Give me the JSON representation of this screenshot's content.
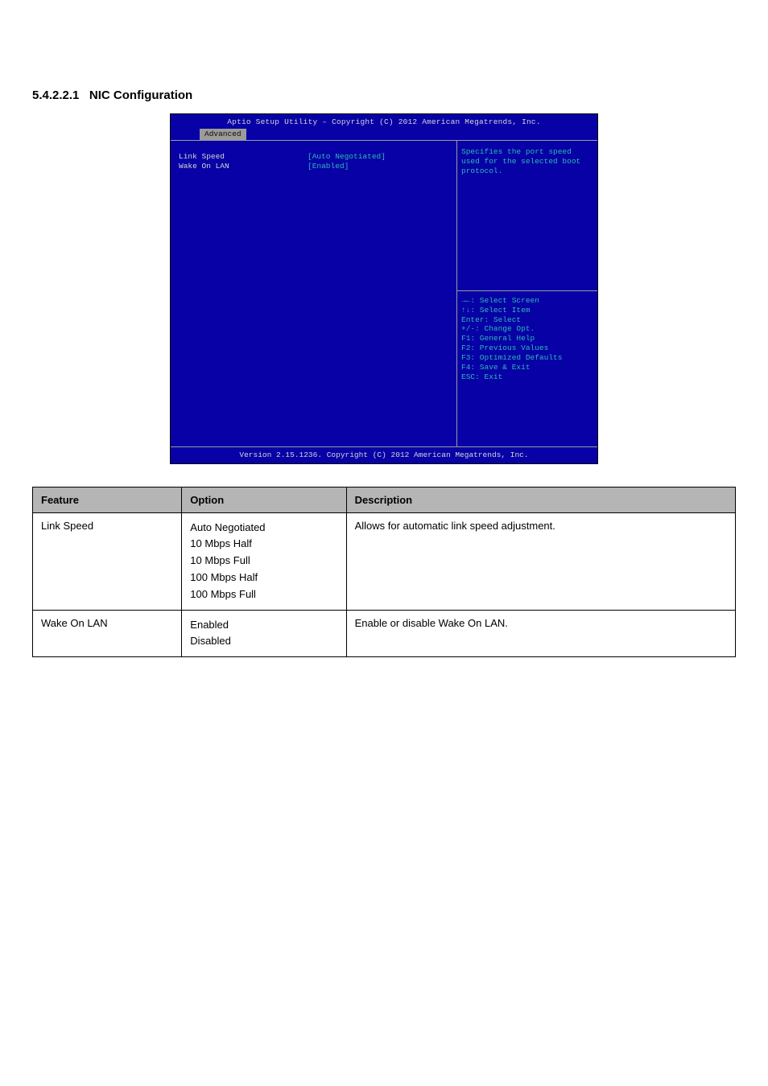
{
  "section_number": "5.4.2.2.1",
  "section_title": "NIC Configuration",
  "bios": {
    "title": "Aptio Setup Utility – Copyright (C) 2012 American Megatrends, Inc.",
    "active_tab": "Advanced",
    "footer": "Version 2.15.1236. Copyright (C) 2012 American Megatrends, Inc.",
    "items": [
      {
        "label": "Link Speed",
        "value": "[Auto Negotiated]",
        "selected": true
      },
      {
        "label": "Wake On LAN",
        "value": "[Enabled]",
        "selected": false
      }
    ],
    "help_text": "Specifies the port speed used for the selected boot protocol.",
    "key_help": [
      "→←: Select Screen",
      "↑↓: Select Item",
      "Enter: Select",
      "+/-: Change Opt.",
      "F1: General Help",
      "F2: Previous Values",
      "F3: Optimized Defaults",
      "F4: Save & Exit",
      "ESC: Exit"
    ]
  },
  "table": {
    "headers": [
      "Feature",
      "Option",
      "Description"
    ],
    "rows": [
      {
        "feature": "Link Speed",
        "options": [
          "Auto Negotiated",
          "10 Mbps Half",
          "10 Mbps Full",
          "100 Mbps Half",
          "100 Mbps Full"
        ],
        "description": "Allows for automatic link speed adjustment."
      },
      {
        "feature": "Wake On LAN",
        "options": [
          "Enabled",
          "Disabled"
        ],
        "description": "Enable or disable Wake On LAN."
      }
    ]
  }
}
